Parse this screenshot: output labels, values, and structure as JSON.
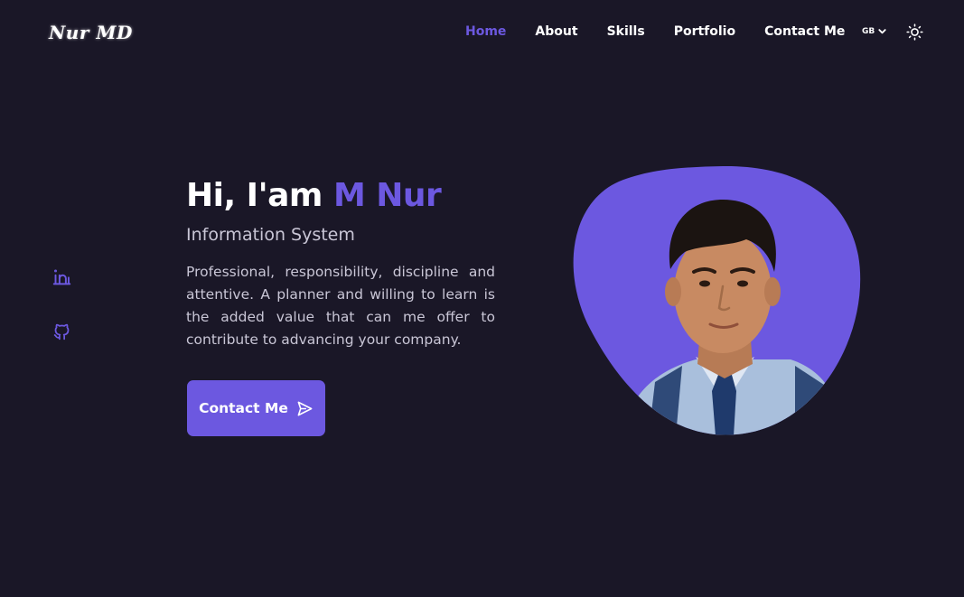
{
  "logo": "Nur MD",
  "nav": {
    "items": [
      {
        "label": "Home",
        "active": true
      },
      {
        "label": "About"
      },
      {
        "label": "Skills"
      },
      {
        "label": "Portfolio"
      },
      {
        "label": "Contact Me"
      }
    ]
  },
  "lang": {
    "code": "GB",
    "icon": "chevron-down-icon"
  },
  "theme_toggle": {
    "icon": "sun-icon"
  },
  "social": [
    {
      "name": "linkedin",
      "icon": "linkedin-icon"
    },
    {
      "name": "github",
      "icon": "github-icon"
    }
  ],
  "hero": {
    "greeting": "Hi, I'am ",
    "name": "M Nur",
    "subtitle": "Information System",
    "description": "Professional, responsibility, discipline and attentive. A planner and willing to learn is the added value that can me offer to contribute to advancing your company.",
    "cta_label": "Contact Me",
    "cta_icon": "send-icon"
  },
  "colors": {
    "background": "#1a1727",
    "accent": "#6c58e0",
    "text": "#ffffff",
    "muted_text": "#c9c6d6"
  }
}
